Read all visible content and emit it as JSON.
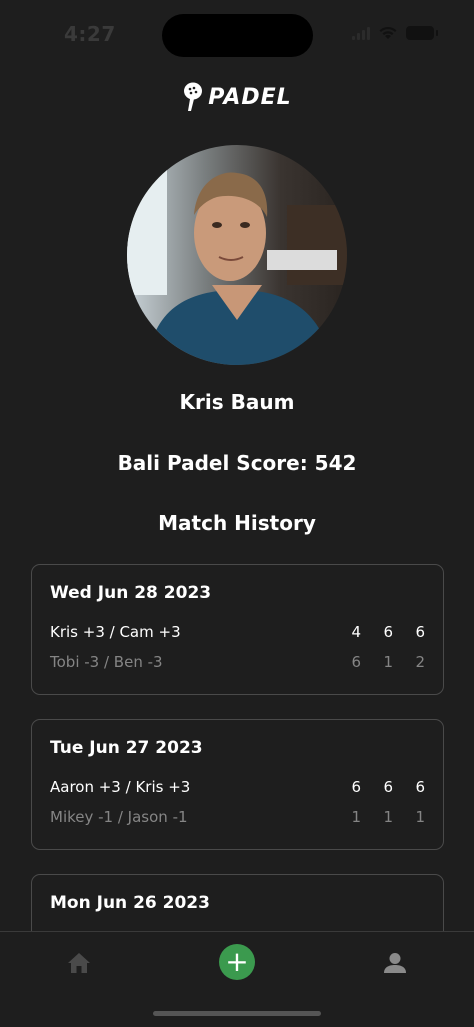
{
  "status_bar": {
    "time": "4:27"
  },
  "logo": {
    "text": "PADEL"
  },
  "profile": {
    "name": "Kris Baum",
    "score_text": "Bali Padel Score: 542"
  },
  "history": {
    "title": "Match History",
    "matches": [
      {
        "date": "Wed Jun 28 2023",
        "team1": {
          "players": "Kris +3 / Cam +3",
          "scores": [
            "4",
            "6",
            "6"
          ]
        },
        "team2": {
          "players": "Tobi -3 / Ben -3",
          "scores": [
            "6",
            "1",
            "2"
          ]
        }
      },
      {
        "date": "Tue Jun 27 2023",
        "team1": {
          "players": "Aaron +3 / Kris +3",
          "scores": [
            "6",
            "6",
            "6"
          ]
        },
        "team2": {
          "players": "Mikey -1 / Jason -1",
          "scores": [
            "1",
            "1",
            "1"
          ]
        }
      },
      {
        "date": "Mon Jun 26 2023"
      }
    ]
  },
  "nav": {
    "home_icon": "home-icon",
    "add_label": "+",
    "profile_icon": "person-icon",
    "accent_color": "#3b9a4e"
  }
}
